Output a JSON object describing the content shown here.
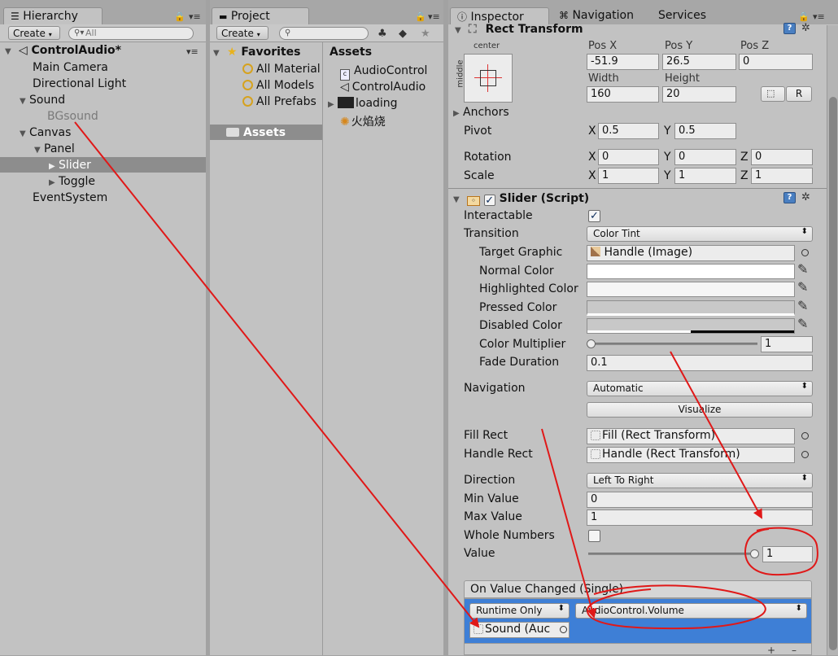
{
  "hierarchy": {
    "tab": "Hierarchy",
    "create": "Create",
    "search_placeholder": "All",
    "scene": "ControlAudio*",
    "items": [
      "Main Camera",
      "Directional Light",
      "Sound",
      "BGsound",
      "Canvas",
      "Panel",
      "Slider",
      "Toggle",
      "EventSystem"
    ]
  },
  "project": {
    "tab": "Project",
    "create": "Create",
    "favorites": "Favorites",
    "fav_items": [
      "All Material",
      "All Models",
      "All Prefabs"
    ],
    "assets_folder": "Assets",
    "assets_header": "Assets",
    "asset_items": [
      "AudioControl",
      "ControlAudio",
      "loading",
      "火焰烧"
    ]
  },
  "inspector": {
    "tabs": [
      "Inspector",
      "Navigation",
      "Services"
    ],
    "rect_transform": {
      "title": "Rect Transform",
      "anchor_h": "center",
      "anchor_v": "middle",
      "pos_x_label": "Pos X",
      "pos_y_label": "Pos Y",
      "pos_z_label": "Pos Z",
      "pos_x": "-51.9",
      "pos_y": "26.5",
      "pos_z": "0",
      "width_label": "Width",
      "height_label": "Height",
      "width": "160",
      "height": "20",
      "r_button": "R",
      "anchors": "Anchors",
      "pivot": "Pivot",
      "pivot_x": "0.5",
      "pivot_y": "0.5",
      "rotation": "Rotation",
      "rot_x": "0",
      "rot_y": "0",
      "rot_z": "0",
      "scale": "Scale",
      "scale_x": "1",
      "scale_y": "1",
      "scale_z": "1",
      "x": "X",
      "y": "Y",
      "z": "Z"
    },
    "slider": {
      "title": "Slider (Script)",
      "interactable": "Interactable",
      "transition": "Transition",
      "transition_value": "Color Tint",
      "target_graphic": "Target Graphic",
      "target_graphic_value": "Handle (Image)",
      "normal_color": "Normal Color",
      "highlighted_color": "Highlighted Color",
      "pressed_color": "Pressed Color",
      "disabled_color": "Disabled Color",
      "color_multiplier": "Color Multiplier",
      "color_multiplier_value": "1",
      "color_multiplier_level": 0,
      "fade_duration": "Fade Duration",
      "fade_duration_value": "0.1",
      "navigation": "Navigation",
      "navigation_value": "Automatic",
      "visualize": "Visualize",
      "fill_rect": "Fill Rect",
      "fill_rect_value": "Fill (Rect Transform)",
      "handle_rect": "Handle Rect",
      "handle_rect_value": "Handle (Rect Transform)",
      "direction": "Direction",
      "direction_value": "Left To Right",
      "min_value": "Min Value",
      "min_value_value": "0",
      "max_value": "Max Value",
      "max_value_value": "1",
      "whole_numbers": "Whole Numbers",
      "value": "Value",
      "value_value": "1",
      "value_level": 1
    },
    "event": {
      "header": "On Value Changed (Single)",
      "runtime": "Runtime Only",
      "function": "AudioControl.Volume",
      "object": "Sound (Auc"
    }
  },
  "colors": {
    "annotation": "#e01818",
    "selection": "#3e7fd6",
    "panel": "#c2c2c2"
  }
}
